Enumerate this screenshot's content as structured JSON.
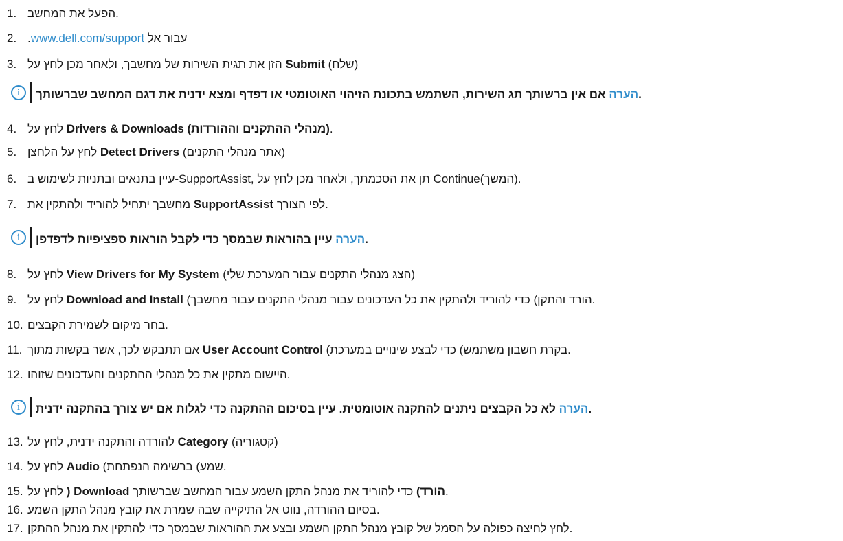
{
  "colors": {
    "link": "#2f8ccb",
    "text": "#1a1a1a",
    "note_icon": "#2f8ccb"
  },
  "icons": {
    "note": "info-circle-icon"
  },
  "steps": [
    {
      "num": "1.",
      "text": ".הפעל את המחשב"
    },
    {
      "num": "2.",
      "pre": "עבור אל ",
      "link": "www.dell.com/support",
      "post": "."
    },
    {
      "num": "3.",
      "pre": "(שלח) ",
      "bold": "Submit",
      "post": " הזן את תגית השירות של מחשבך, ולאחר מכן לחץ על"
    },
    {
      "num": "4.",
      "bold": "(מנהלי ההתקנים וההורדות) Drivers & Downloads",
      "post": " לחץ על",
      "lead": "."
    },
    {
      "num": "5.",
      "pre": "(אתר מנהלי התקנים) ",
      "bold": "Detect Drivers",
      "post": " לחץ על הלחצן",
      "lead": "."
    },
    {
      "num": "6.",
      "text": ".(המשך)Continue תן את הסכמתך, ולאחר מכן לחץ על ,SupportAssist-עיין בתנאים ובתניות לשימוש ב"
    },
    {
      "num": "7.",
      "pre": ".לפי הצורך ",
      "bold": "SupportAssist",
      "post": " מחשבך יתחיל להוריד ולהתקין את"
    },
    {
      "num": "8.",
      "pre": "(הצג מנהלי התקנים עבור המערכת שלי) ",
      "bold": "View Drivers for My System",
      "post": " לחץ על",
      "lead": "."
    },
    {
      "num": "9.",
      "pre": ".הורד והתקן) כדי להוריד ולהתקין את כל העדכונים עבור מנהלי התקנים עבור מחשבך) ",
      "bold": "Download and Install",
      "post": " לחץ על"
    },
    {
      "num": "10.",
      "text": ".בחר מיקום לשמירת הקבצים"
    },
    {
      "num": "11.",
      "pre": ".בקרת חשבון משתמש) כדי לבצע שינויים במערכת) ",
      "bold": "User Account Control",
      "post": " אם תתבקש לכך, אשר בקשות מתוך"
    },
    {
      "num": "12.",
      "text": ".היישום מתקין את כל מנהלי ההתקנים והעדכונים שזוהו"
    },
    {
      "num": "13.",
      "pre": "(קטגוריה) ",
      "bold": "Category",
      "post": " להורדה והתקנה ידנית, לחץ על",
      "lead": "."
    },
    {
      "num": "14.",
      "pre": ".שמע) ברשימה הנפתחת) ",
      "bold": "Audio",
      "post": " לחץ על"
    },
    {
      "num": "15.",
      "pre": ".",
      "bold": "הורד)",
      "mid": " כדי להוריד את מנהל התקן השמע עבור המחשב שברשותך ",
      "bold2": "Download (",
      "post": " לחץ על"
    },
    {
      "num": "16.",
      "text": ".בסיום ההורדה, נווט אל התיקייה שבה שמרת את קובץ מנהל התקן השמע"
    },
    {
      "num": "17.",
      "text": ".לחץ לחיצה כפולה על הסמל של קובץ מנהל התקן השמע ובצע את ההוראות שבמסך כדי להתקין את מנהל ההתקן"
    }
  ],
  "notes": [
    {
      "label": "הערה",
      "text": ".הערה אם אין ברשותך תג השירות, השתמש בתכונת הזיהוי האוטומטי או דפדף ומצא ידנית את דגם המחשב שברשותך"
    },
    {
      "label": "הערה",
      "text": ".הערה עיין בהוראות שבמסך כדי לקבל הוראות ספציפיות לדפדפן"
    },
    {
      "label": "הערה",
      "text": ".הערה לא כל הקבצים ניתנים להתקנה אוטומטית. עיין בסיכום ההתקנה כדי לגלות אם יש צורך בהתקנה ידנית"
    }
  ]
}
